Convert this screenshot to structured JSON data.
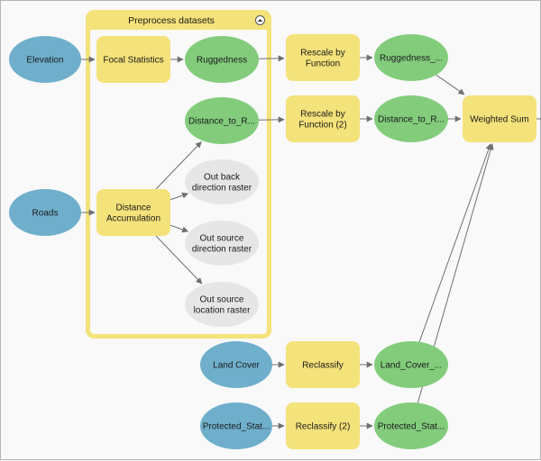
{
  "colors": {
    "background": "#f9f9f9",
    "input_variable": "#6fafcc",
    "tool": "#f4e27a",
    "derived_data": "#82cc7c",
    "intermediate_output": "#e6e6e6",
    "group_border": "#f4e27a",
    "connector": "#707070"
  },
  "group": {
    "title": "Preprocess datasets",
    "collapse_icon": "collapse-chevron-up-icon"
  },
  "nodes": [
    {
      "id": "elevation",
      "type": "input",
      "lines": [
        "Elevation"
      ]
    },
    {
      "id": "focal_statistics",
      "type": "tool",
      "lines": [
        "Focal Statistics"
      ]
    },
    {
      "id": "ruggedness",
      "type": "derived",
      "lines": [
        "Ruggedness"
      ]
    },
    {
      "id": "rescale1",
      "type": "tool",
      "lines": [
        "Rescale by",
        "Function"
      ]
    },
    {
      "id": "ruggedness_out",
      "type": "derived",
      "lines": [
        "Ruggedness_..."
      ]
    },
    {
      "id": "distance_to_r1",
      "type": "derived",
      "lines": [
        "Distance_to_R..."
      ]
    },
    {
      "id": "rescale2",
      "type": "tool",
      "lines": [
        "Rescale by",
        "Function (2)"
      ]
    },
    {
      "id": "distance_to_r2",
      "type": "derived",
      "lines": [
        "Distance_to_R..."
      ]
    },
    {
      "id": "weighted_sum",
      "type": "tool",
      "lines": [
        "Weighted Sum"
      ]
    },
    {
      "id": "roads",
      "type": "input",
      "lines": [
        "Roads"
      ]
    },
    {
      "id": "distance_accumulation",
      "type": "tool",
      "lines": [
        "Distance",
        "Accumulation"
      ]
    },
    {
      "id": "out_back_direction",
      "type": "intermediate",
      "lines": [
        "Out back",
        "direction raster"
      ]
    },
    {
      "id": "out_source_direction",
      "type": "intermediate",
      "lines": [
        "Out source",
        "direction raster"
      ]
    },
    {
      "id": "out_source_location",
      "type": "intermediate",
      "lines": [
        "Out source",
        "location raster"
      ]
    },
    {
      "id": "land_cover",
      "type": "input",
      "lines": [
        "Land Cover"
      ]
    },
    {
      "id": "reclassify1",
      "type": "tool",
      "lines": [
        "Reclassify"
      ]
    },
    {
      "id": "land_cover_out",
      "type": "derived",
      "lines": [
        "Land_Cover_..."
      ]
    },
    {
      "id": "protected_stat_in",
      "type": "input",
      "lines": [
        "Protected_Stat..."
      ]
    },
    {
      "id": "reclassify2",
      "type": "tool",
      "lines": [
        "Reclassify (2)"
      ]
    },
    {
      "id": "protected_stat_out",
      "type": "derived",
      "lines": [
        "Protected_Stat..."
      ]
    }
  ],
  "connections": [
    [
      "elevation",
      "focal_statistics"
    ],
    [
      "focal_statistics",
      "ruggedness"
    ],
    [
      "ruggedness",
      "rescale1"
    ],
    [
      "rescale1",
      "ruggedness_out"
    ],
    [
      "ruggedness_out",
      "weighted_sum"
    ],
    [
      "distance_to_r1",
      "rescale2"
    ],
    [
      "rescale2",
      "distance_to_r2"
    ],
    [
      "distance_to_r2",
      "weighted_sum"
    ],
    [
      "roads",
      "distance_accumulation"
    ],
    [
      "distance_accumulation",
      "distance_to_r1"
    ],
    [
      "distance_accumulation",
      "out_back_direction"
    ],
    [
      "distance_accumulation",
      "out_source_direction"
    ],
    [
      "distance_accumulation",
      "out_source_location"
    ],
    [
      "land_cover",
      "reclassify1"
    ],
    [
      "reclassify1",
      "land_cover_out"
    ],
    [
      "land_cover_out",
      "weighted_sum"
    ],
    [
      "protected_stat_in",
      "reclassify2"
    ],
    [
      "reclassify2",
      "protected_stat_out"
    ],
    [
      "protected_stat_out",
      "weighted_sum"
    ]
  ]
}
